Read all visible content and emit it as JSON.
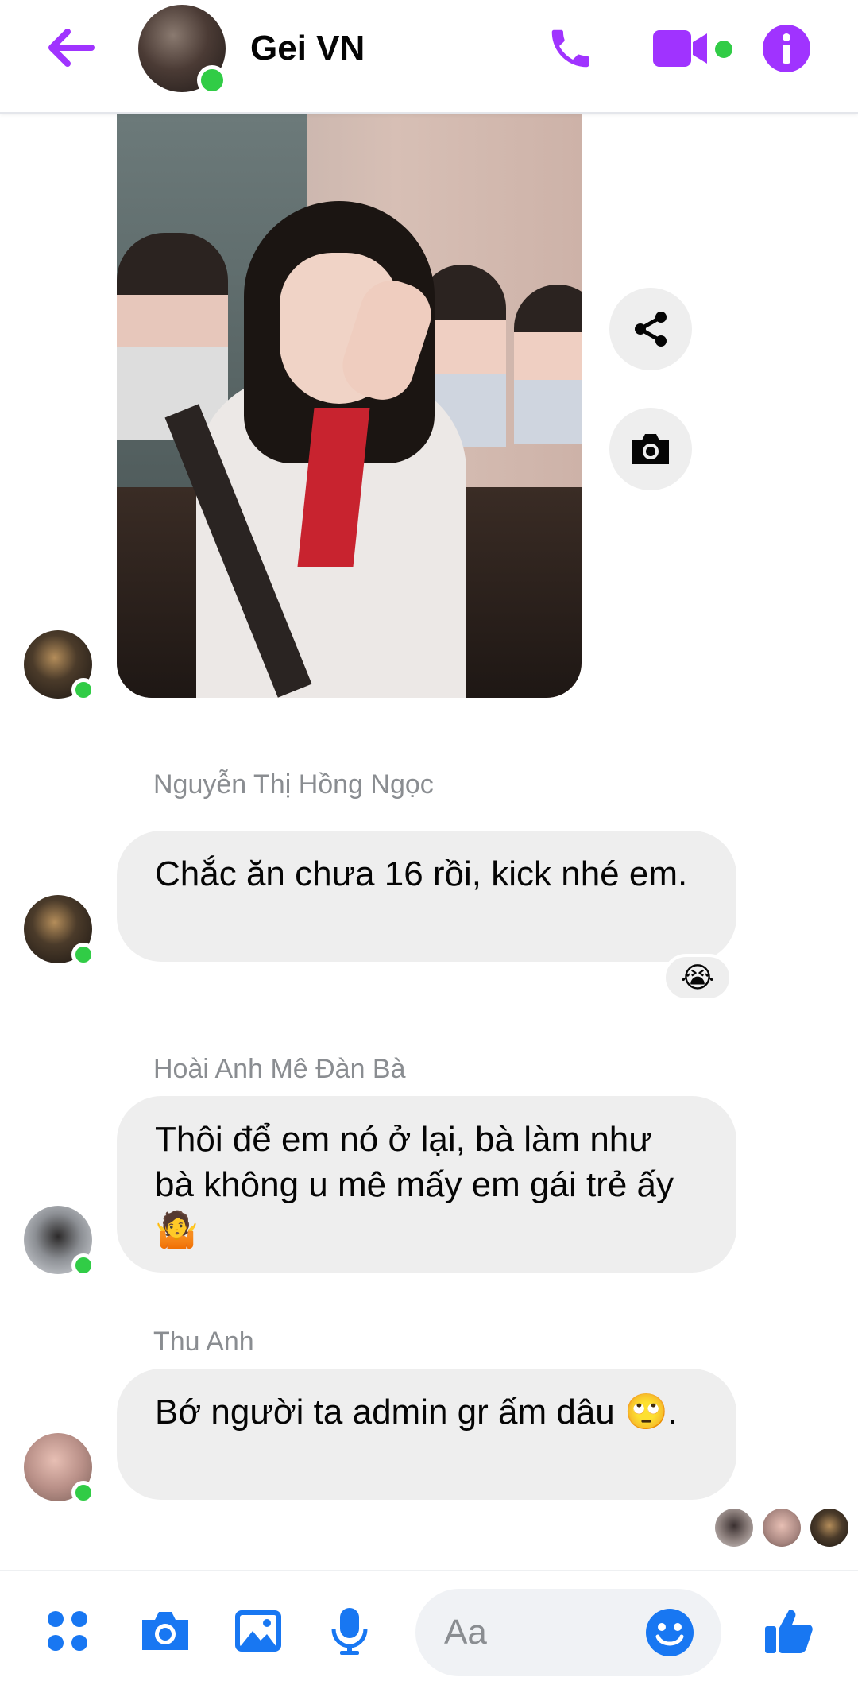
{
  "header": {
    "title": "Gei VN",
    "colors": {
      "accent": "#A033FF",
      "online": "#31CC46"
    }
  },
  "messages": [
    {
      "sender": "Nguyễn Thị Hồng Ngọc",
      "text": "Chắc ăn chưa 16 rồi, kick nhé em.",
      "reaction": "😭"
    },
    {
      "sender": "Hoài Anh Mê Đàn Bà",
      "text": "Thôi để em nó ở lại, bà làm như bà không u mê mấy em gái trẻ ấy 🤷"
    },
    {
      "sender": "Thu Anh",
      "text": "Bớ người ta admin gr ấm dâu 🙄."
    }
  ],
  "composer": {
    "placeholder": "Aa"
  },
  "icons": {
    "back": "back-arrow-icon",
    "call": "phone-icon",
    "video": "video-camera-icon",
    "info": "info-icon",
    "share": "share-icon",
    "photo": "camera-icon",
    "apps": "apps-grid-icon",
    "gallery": "image-icon",
    "mic": "microphone-icon",
    "emoji": "smiley-icon",
    "like": "thumbs-up-icon"
  }
}
